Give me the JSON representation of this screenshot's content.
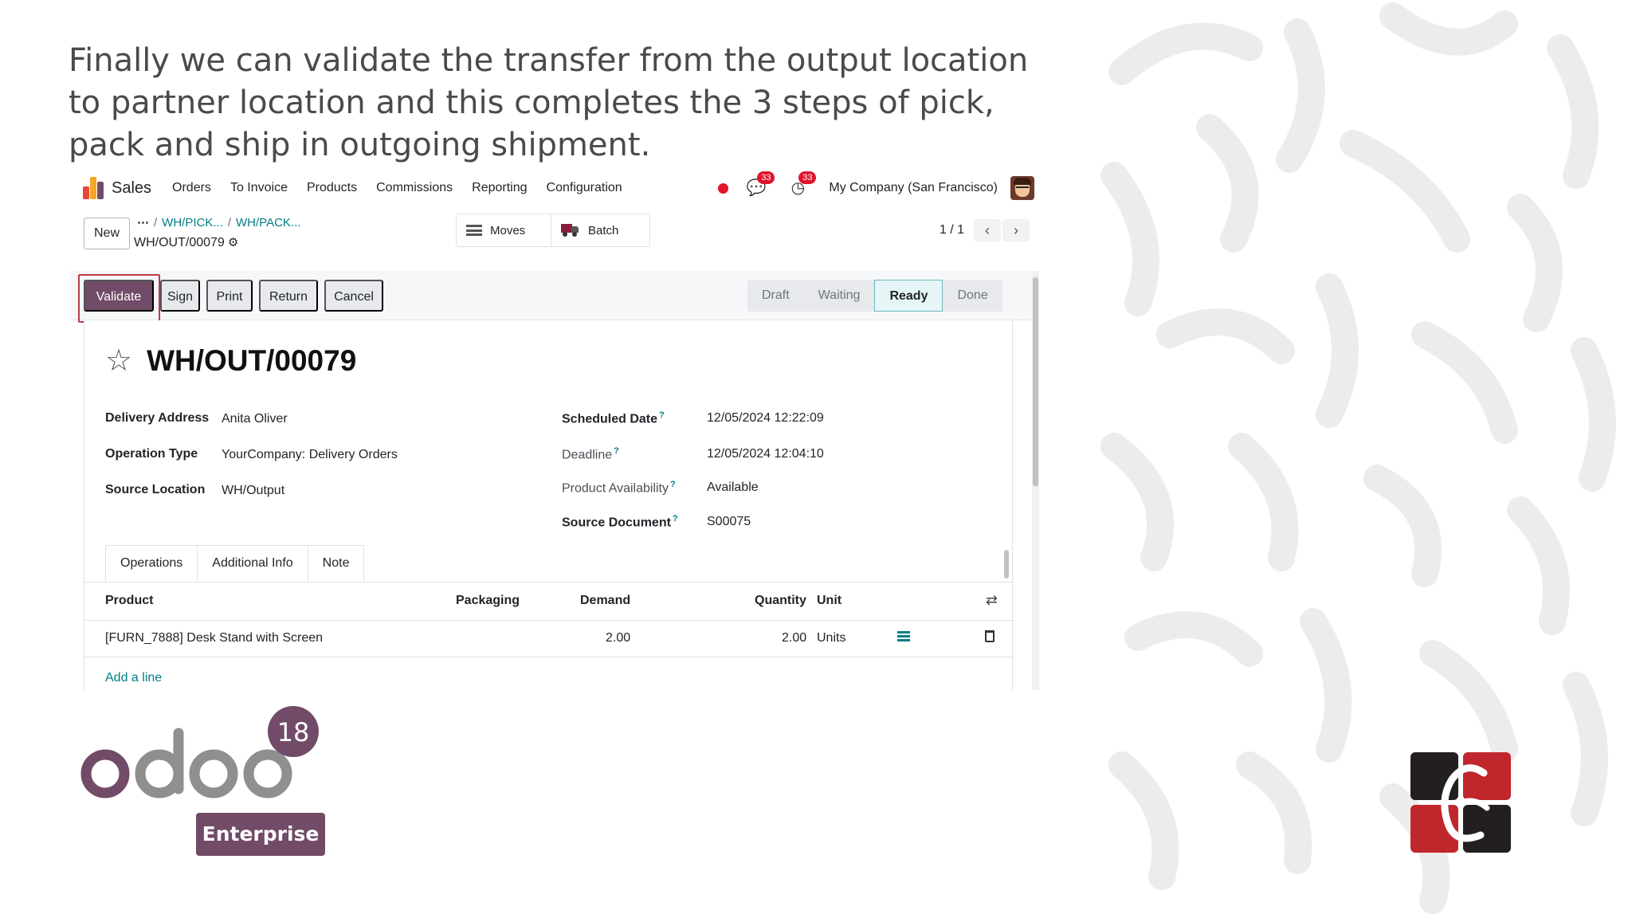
{
  "caption": "Finally we can validate the transfer from the output location to partner location and this completes the 3 steps of pick, pack and ship in outgoing shipment.",
  "navbar": {
    "app_name": "Sales",
    "menu": [
      "Orders",
      "To Invoice",
      "Products",
      "Commissions",
      "Reporting",
      "Configuration"
    ],
    "messages_count": "33",
    "activities_count": "33",
    "company": "My Company (San Francisco)"
  },
  "control_panel": {
    "new_label": "New",
    "breadcrumbs": [
      "WH/PICK...",
      "WH/PACK..."
    ],
    "record_name": "WH/OUT/00079",
    "smart_buttons": {
      "moves": "Moves",
      "batch": "Batch"
    },
    "pager": "1 / 1"
  },
  "statusbar": {
    "buttons": [
      "Validate",
      "Sign",
      "Print",
      "Return",
      "Cancel"
    ],
    "stages": [
      "Draft",
      "Waiting",
      "Ready",
      "Done"
    ],
    "active_stage": "Ready"
  },
  "form": {
    "title": "WH/OUT/00079",
    "left_fields": [
      {
        "label": "Delivery Address",
        "value": "Anita Oliver"
      },
      {
        "label": "Operation Type",
        "value": "YourCompany: Delivery Orders"
      },
      {
        "label": "Source Location",
        "value": "WH/Output"
      }
    ],
    "right_fields": [
      {
        "label": "Scheduled Date",
        "value": "12/05/2024 12:22:09"
      },
      {
        "label": "Deadline",
        "value": "12/05/2024 12:04:10"
      },
      {
        "label": "Product Availability",
        "value": "Available"
      },
      {
        "label": "Source Document",
        "value": "S00075"
      }
    ],
    "tabs": [
      "Operations",
      "Additional Info",
      "Note"
    ],
    "table": {
      "headers": {
        "product": "Product",
        "packaging": "Packaging",
        "demand": "Demand",
        "quantity": "Quantity",
        "unit": "Unit"
      },
      "rows": [
        {
          "product": "[FURN_7888] Desk Stand with Screen",
          "packaging": "",
          "demand": "2.00",
          "quantity": "2.00",
          "unit": "Units"
        }
      ],
      "add_line": "Add a line"
    }
  },
  "branding": {
    "logo_text": "odoo",
    "version": "18",
    "edition": "Enterprise"
  },
  "colors": {
    "primary": "#714b67",
    "link": "#017e84",
    "warning": "#9c6a00",
    "success": "#2c8a3f",
    "badge": "#e0142a"
  }
}
